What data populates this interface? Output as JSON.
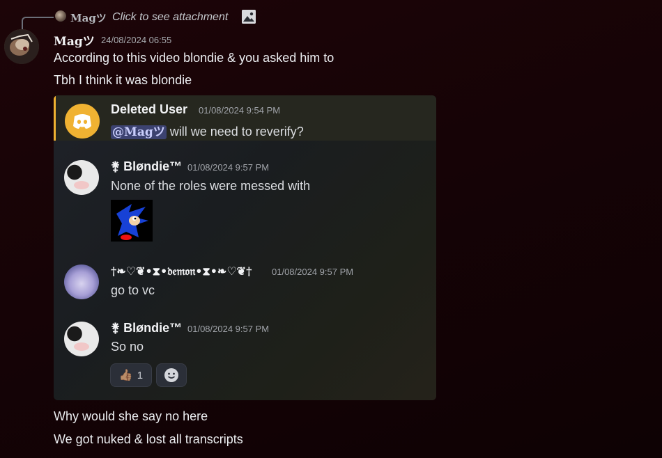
{
  "reply": {
    "author": "Magツ",
    "text": "Click to see attachment"
  },
  "message": {
    "author": "Magツ",
    "timestamp": "24/08/2024 06:55",
    "lines": [
      "According to this video blondie & you asked him to",
      "Tbh I think it was blondie"
    ],
    "after_lines": [
      "Why would she say no here",
      "We got nuked & lost all transcripts"
    ]
  },
  "embed": {
    "messages": [
      {
        "author": "Deleted User",
        "timestamp": "01/08/2024 9:54 PM",
        "mention": "@Magツ",
        "text": " will we need to reverify?"
      },
      {
        "author": "⚵ Bløndie™",
        "timestamp": "01/08/2024 9:57 PM",
        "text": "None of the roles were messed with"
      },
      {
        "author": "†❧♡❦•⧗•𝔡𝔢𝔪𝔬𝔫•⧗•❧♡❦†",
        "timestamp": "01/08/2024 9:57 PM",
        "text": "go to vc"
      },
      {
        "author": "⚵ Bløndie™",
        "timestamp": "01/08/2024 9:57 PM",
        "text": "So no"
      }
    ],
    "reaction": {
      "emoji": "👍🏽",
      "count": "1"
    }
  },
  "icons": {
    "reply_image": "image-icon",
    "discord": "discord-logo-icon",
    "add_reaction": "add-reaction-icon"
  },
  "colors": {
    "accent": "#f0b232",
    "mention_bg": "#3c4270"
  }
}
